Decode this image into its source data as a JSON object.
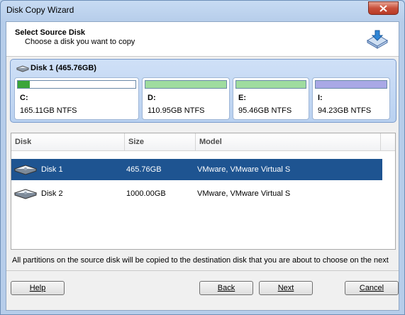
{
  "window": {
    "title": "Disk Copy Wizard"
  },
  "header": {
    "title": "Select Source Disk",
    "subtitle": "Choose a disk you want to copy"
  },
  "disk_panel": {
    "label": "Disk 1 (465.76GB)",
    "partitions": [
      {
        "letter": "C:",
        "info": "165.11GB NTFS",
        "used_fraction": 0.1,
        "color": "#3aa53a"
      },
      {
        "letter": "D:",
        "info": "110.95GB NTFS",
        "used_fraction": 1.0,
        "color": "#9fdc9f"
      },
      {
        "letter": "E:",
        "info": "95.46GB NTFS",
        "used_fraction": 1.0,
        "color": "#9fdc9f"
      },
      {
        "letter": "I:",
        "info": "94.23GB NTFS",
        "used_fraction": 1.0,
        "color": "#a9a8e6"
      }
    ]
  },
  "list": {
    "columns": [
      "Disk",
      "Size",
      "Model"
    ],
    "rows": [
      {
        "disk": "Disk 1",
        "size": "465.76GB",
        "model": "VMware, VMware Virtual S",
        "selected": true
      },
      {
        "disk": "Disk 2",
        "size": "1000.00GB",
        "model": "VMware, VMware Virtual S",
        "selected": false
      }
    ]
  },
  "footer_note": "All partitions on the source disk will be copied to the destination disk that you are about to choose on the next",
  "buttons": {
    "help": "Help",
    "back": "Back",
    "next": "Next",
    "cancel": "Cancel"
  }
}
